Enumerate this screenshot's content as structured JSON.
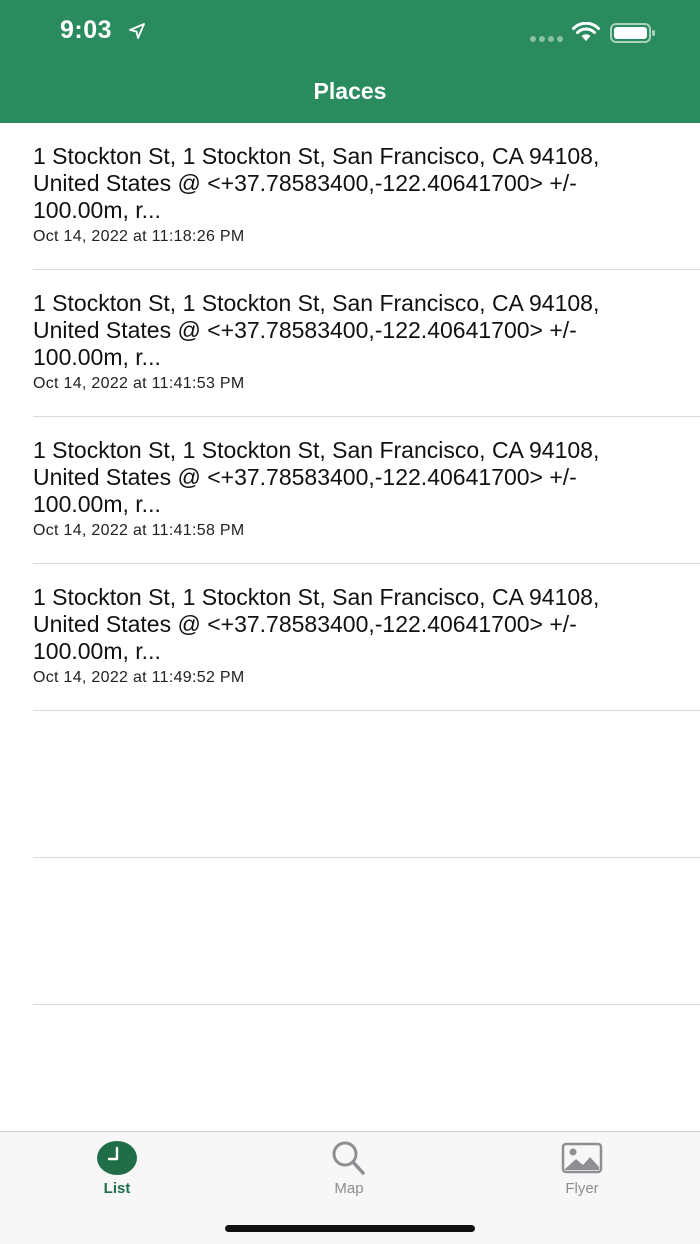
{
  "status_bar": {
    "time": "9:03"
  },
  "nav": {
    "title": "Places"
  },
  "places": [
    {
      "title": "1 Stockton St, 1 Stockton St, San Francisco, CA 94108, United States @ <+37.78583400,-122.40641700> +/- 100.00m, r...",
      "timestamp": "Oct 14, 2022 at 11:18:26 PM"
    },
    {
      "title": "1 Stockton St, 1 Stockton St, San Francisco, CA 94108, United States @ <+37.78583400,-122.40641700> +/- 100.00m, r...",
      "timestamp": "Oct 14, 2022 at 11:41:53 PM"
    },
    {
      "title": "1 Stockton St, 1 Stockton St, San Francisco, CA 94108, United States @ <+37.78583400,-122.40641700> +/- 100.00m, r...",
      "timestamp": "Oct 14, 2022 at 11:41:58 PM"
    },
    {
      "title": "1 Stockton St, 1 Stockton St, San Francisco, CA 94108, United States @ <+37.78583400,-122.40641700> +/- 100.00m, r...",
      "timestamp": "Oct 14, 2022 at 11:49:52 PM"
    }
  ],
  "tabs": [
    {
      "label": "List",
      "icon": "clock-icon",
      "active": true
    },
    {
      "label": "Map",
      "icon": "search-icon",
      "active": false
    },
    {
      "label": "Flyer",
      "icon": "photo-icon",
      "active": false
    }
  ],
  "colors": {
    "header": "#2a8c5e",
    "tab_active": "#1f6e47",
    "tab_inactive": "#8e8e93"
  }
}
